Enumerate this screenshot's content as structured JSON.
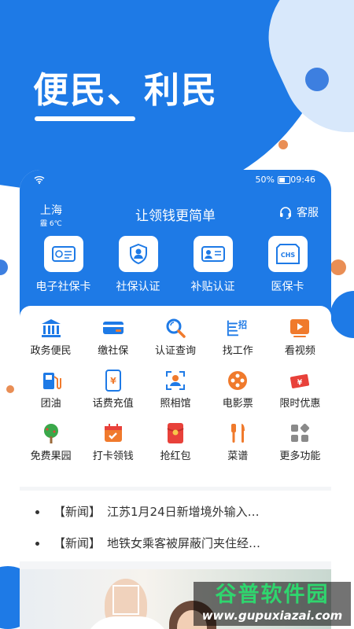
{
  "hero": {
    "title": "便民、利民"
  },
  "status_bar": {
    "battery": "50%",
    "time": "09:46"
  },
  "header": {
    "city": "上海",
    "weather": "霾 6℃",
    "slogan": "让领钱更简单",
    "service_label": "客服"
  },
  "big_tiles": [
    {
      "label": "电子社保卡",
      "icon": "social-card-icon"
    },
    {
      "label": "社保认证",
      "icon": "shield-person-icon"
    },
    {
      "label": "补贴认证",
      "icon": "id-card-icon"
    },
    {
      "label": "医保卡",
      "icon": "chs-icon",
      "icon_text": "CHS"
    }
  ],
  "grid": [
    {
      "label": "政务便民",
      "icon": "government-building-icon",
      "color": "#1e7ae6"
    },
    {
      "label": "缴社保",
      "icon": "payment-card-icon",
      "color": "#1e7ae6"
    },
    {
      "label": "认证查询",
      "icon": "magnifier-icon",
      "color": "#1e7ae6"
    },
    {
      "label": "找工作",
      "icon": "job-icon",
      "color": "#1e7ae6",
      "icon_text": "招"
    },
    {
      "label": "看视频",
      "icon": "video-play-icon",
      "color": "#f07a2c"
    },
    {
      "label": "团油",
      "icon": "fuel-pump-icon",
      "color": "#1e7ae6"
    },
    {
      "label": "话费充值",
      "icon": "phone-recharge-icon",
      "color": "#1e7ae6",
      "icon_text": "¥"
    },
    {
      "label": "照相馆",
      "icon": "camera-face-icon",
      "color": "#1e7ae6"
    },
    {
      "label": "电影票",
      "icon": "film-reel-icon",
      "color": "#f07a2c"
    },
    {
      "label": "限时优惠",
      "icon": "coupon-icon",
      "color": "#e8413a",
      "icon_text": "¥"
    },
    {
      "label": "免费果园",
      "icon": "tree-icon",
      "color": "#3aa84a"
    },
    {
      "label": "打卡领钱",
      "icon": "calendar-check-icon",
      "color": "#f07a2c"
    },
    {
      "label": "抢红包",
      "icon": "red-envelope-icon",
      "color": "#e8413a"
    },
    {
      "label": "菜谱",
      "icon": "cutlery-icon",
      "color": "#f07a2c"
    },
    {
      "label": "更多功能",
      "icon": "more-grid-icon",
      "color": "#7a7a7a"
    }
  ],
  "news": [
    {
      "tag": "【新闻】",
      "text": "江苏1月24日新增境外输入…"
    },
    {
      "tag": "【新闻】",
      "text": "地铁女乘客被屏蔽门夹住经…"
    }
  ],
  "watermark": {
    "title": "谷普软件园",
    "url": "www.gupuxiazai.com"
  }
}
